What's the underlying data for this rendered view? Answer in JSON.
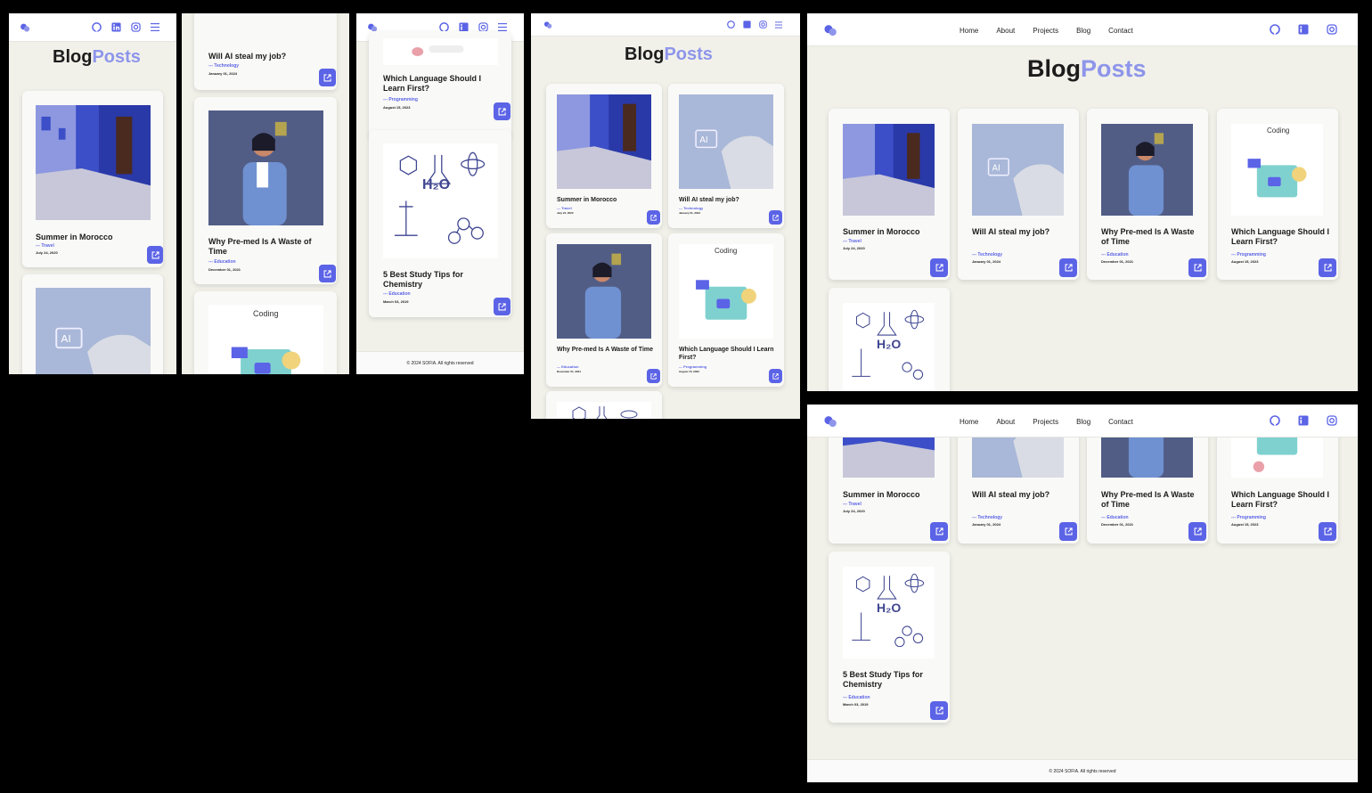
{
  "brand": {
    "logo": "logo-icon",
    "accent": "#5b63e6",
    "accent_light": "#8e95ea",
    "bg": "#f1f1ea"
  },
  "nav": {
    "links": [
      "Home",
      "About",
      "Projects",
      "Blog",
      "Contact"
    ],
    "icons": [
      "github-icon",
      "linkedin-icon",
      "instagram-icon"
    ],
    "menu_icon": "menu-icon"
  },
  "heading": {
    "part1": "Blog",
    "part2": "Posts"
  },
  "posts": [
    {
      "title": "Summer in Morocco",
      "category": "Travel",
      "date": "July 24, 2020",
      "image": "morocco-street-image"
    },
    {
      "title": "Will AI steal my job?",
      "category": "Technology",
      "date": "January 01, 2024",
      "image": "robot-hand-image"
    },
    {
      "title": "Why Pre-med Is A Waste of Time",
      "category": "Education",
      "date": "December 01, 2021",
      "image": "woman-illustration-image"
    },
    {
      "title": "Which Language Should I Learn First?",
      "category": "Programming",
      "date": "August 15, 2023",
      "image": "coding-illustration-image",
      "image_caption": "Coding"
    },
    {
      "title": "5 Best Study Tips for Chemistry",
      "category": "Education",
      "date": "March 03, 2019",
      "image": "chemistry-doodle-image",
      "image_caption": "H₂O"
    }
  ],
  "category_prefix": "---",
  "footer": {
    "text": "© 2024 SOFIA. All rights reserved"
  }
}
